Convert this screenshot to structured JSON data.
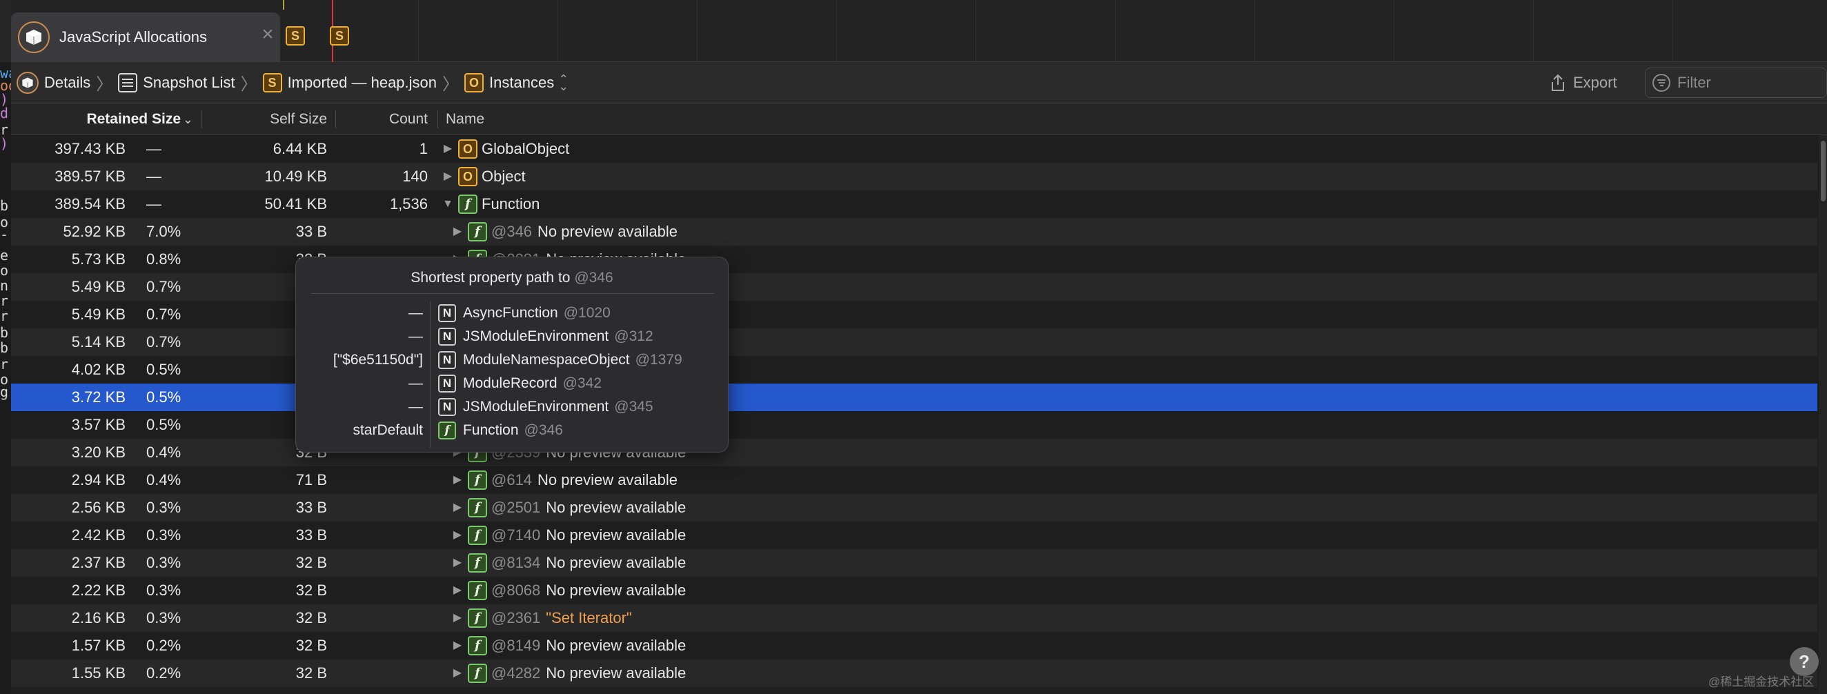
{
  "timeline": {
    "title": "JavaScript Allocations",
    "close_icon": "close-icon",
    "markers": [
      "S",
      "S"
    ]
  },
  "gutter_chars": [
    {
      "c": ".",
      "color": "#5aa0e6"
    },
    {
      "c": "wa",
      "color": "#5aa0e6"
    },
    {
      "c": "oo",
      "color": "#e08a5c"
    },
    {
      "c": ")",
      "color": "#c97ee0"
    },
    {
      "c": "d",
      "color": "#c97ee0"
    },
    {
      "c": "r",
      "color": "#d9d9d9"
    },
    {
      "c": ")",
      "color": "#c97ee0"
    },
    {
      "c": "b",
      "color": "#d9d9d9"
    },
    {
      "c": "o",
      "color": "#d9d9d9"
    },
    {
      "c": "-",
      "color": "#d9d9d9"
    },
    {
      "c": "e",
      "color": "#d9d9d9"
    },
    {
      "c": "o",
      "color": "#d9d9d9"
    },
    {
      "c": "n",
      "color": "#d9d9d9"
    },
    {
      "c": "r",
      "color": "#d9d9d9"
    },
    {
      "c": "r",
      "color": "#d9d9d9"
    },
    {
      "c": "b",
      "color": "#d9d9d9"
    },
    {
      "c": "b",
      "color": "#d9d9d9"
    },
    {
      "c": "r",
      "color": "#d9d9d9"
    },
    {
      "c": "o",
      "color": "#d9d9d9"
    },
    {
      "c": "g",
      "color": "#d9d9d9"
    }
  ],
  "navbar": {
    "breadcrumbs": [
      {
        "label": "Details",
        "icon": "box-icon"
      },
      {
        "label": "Snapshot List",
        "icon": "list-icon"
      },
      {
        "label": "Imported — heap.json",
        "icon": "snapshot-icon",
        "badge": "S"
      },
      {
        "label": "Instances",
        "icon": "object-icon",
        "badge": "O"
      }
    ],
    "export_label": "Export",
    "filter_placeholder": "Filter"
  },
  "table": {
    "columns": {
      "retained": "Retained Size",
      "self": "Self Size",
      "count": "Count",
      "name": "Name"
    },
    "rows": [
      {
        "retained": "397.43 KB",
        "pct": "—",
        "self": "6.44 KB",
        "count": "1",
        "indent": 0,
        "expanded": false,
        "badge": "O",
        "id": "",
        "name": "GlobalObject",
        "alt": false
      },
      {
        "retained": "389.57 KB",
        "pct": "—",
        "self": "10.49 KB",
        "count": "140",
        "indent": 0,
        "expanded": false,
        "badge": "O",
        "id": "",
        "name": "Object",
        "alt": true
      },
      {
        "retained": "389.54 KB",
        "pct": "—",
        "self": "50.41 KB",
        "count": "1,536",
        "indent": 0,
        "expanded": true,
        "badge": "f",
        "id": "",
        "name": "Function",
        "alt": false
      },
      {
        "retained": "52.92 KB",
        "pct": "7.0%",
        "self": "33 B",
        "count": "",
        "indent": 1,
        "badge": "f",
        "id": "@346",
        "name": "No preview available",
        "alt": true
      },
      {
        "retained": "5.73 KB",
        "pct": "0.8%",
        "self": "32 B",
        "count": "",
        "indent": 1,
        "badge": "f",
        "id": "@2081",
        "name": "No preview available",
        "alt": false
      },
      {
        "retained": "5.49 KB",
        "pct": "0.7%",
        "self": "33 B",
        "count": "",
        "indent": 1,
        "badge": "f",
        "id": "",
        "name": "",
        "alt": true
      },
      {
        "retained": "5.49 KB",
        "pct": "0.7%",
        "self": "33 B",
        "count": "",
        "indent": 1,
        "badge": "f",
        "id": "",
        "name": "",
        "alt": false
      },
      {
        "retained": "5.14 KB",
        "pct": "0.7%",
        "self": "32 B",
        "count": "",
        "indent": 1,
        "badge": "f",
        "id": "",
        "name": "",
        "alt": true
      },
      {
        "retained": "4.02 KB",
        "pct": "0.5%",
        "self": "32 B",
        "count": "",
        "indent": 1,
        "badge": "f",
        "id": "",
        "name": "",
        "alt": false
      },
      {
        "retained": "3.72 KB",
        "pct": "0.5%",
        "self": "32 B",
        "count": "",
        "indent": 1,
        "badge": "f",
        "id": "",
        "name": "",
        "alt": false,
        "selected": true
      },
      {
        "retained": "3.57 KB",
        "pct": "0.5%",
        "self": "36 B",
        "count": "",
        "indent": 1,
        "badge": "f",
        "id": "",
        "name": "",
        "alt": false
      },
      {
        "retained": "3.20 KB",
        "pct": "0.4%",
        "self": "32 B",
        "count": "",
        "indent": 1,
        "badge": "f",
        "id": "@2339",
        "name": "No preview available",
        "alt": true
      },
      {
        "retained": "2.94 KB",
        "pct": "0.4%",
        "self": "71 B",
        "count": "",
        "indent": 1,
        "badge": "f",
        "id": "@614",
        "name": "No preview available",
        "alt": false
      },
      {
        "retained": "2.56 KB",
        "pct": "0.3%",
        "self": "33 B",
        "count": "",
        "indent": 1,
        "badge": "f",
        "id": "@2501",
        "name": "No preview available",
        "alt": true
      },
      {
        "retained": "2.42 KB",
        "pct": "0.3%",
        "self": "33 B",
        "count": "",
        "indent": 1,
        "badge": "f",
        "id": "@7140",
        "name": "No preview available",
        "alt": false
      },
      {
        "retained": "2.37 KB",
        "pct": "0.3%",
        "self": "32 B",
        "count": "",
        "indent": 1,
        "badge": "f",
        "id": "@8134",
        "name": "No preview available",
        "alt": true
      },
      {
        "retained": "2.22 KB",
        "pct": "0.3%",
        "self": "32 B",
        "count": "",
        "indent": 1,
        "badge": "f",
        "id": "@8068",
        "name": "No preview available",
        "alt": false
      },
      {
        "retained": "2.16 KB",
        "pct": "0.3%",
        "self": "32 B",
        "count": "",
        "indent": 1,
        "badge": "f",
        "id": "@2361",
        "name": "\"Set Iterator\"",
        "string": true,
        "alt": true
      },
      {
        "retained": "1.57 KB",
        "pct": "0.2%",
        "self": "32 B",
        "count": "",
        "indent": 1,
        "badge": "f",
        "id": "@8149",
        "name": "No preview available",
        "alt": false
      },
      {
        "retained": "1.55 KB",
        "pct": "0.2%",
        "self": "32 B",
        "count": "",
        "indent": 1,
        "badge": "f",
        "id": "@4282",
        "name": "No preview available",
        "alt": true
      }
    ]
  },
  "popover": {
    "title": "Shortest property path to",
    "title_id": "@346",
    "rows": [
      {
        "key": "—",
        "badge": "N",
        "name": "AsyncFunction",
        "id": "@1020"
      },
      {
        "key": "—",
        "badge": "N",
        "name": "JSModuleEnvironment",
        "id": "@312"
      },
      {
        "key": "[\"$6e51150d\"]",
        "badge": "N",
        "name": "ModuleNamespaceObject",
        "id": "@1379"
      },
      {
        "key": "—",
        "badge": "N",
        "name": "ModuleRecord",
        "id": "@342"
      },
      {
        "key": "—",
        "badge": "N",
        "name": "JSModuleEnvironment",
        "id": "@345"
      },
      {
        "key": "starDefault",
        "badge": "f",
        "name": "Function",
        "id": "@346"
      }
    ]
  },
  "help_label": "?",
  "watermark": "@稀土掘金技术社区"
}
